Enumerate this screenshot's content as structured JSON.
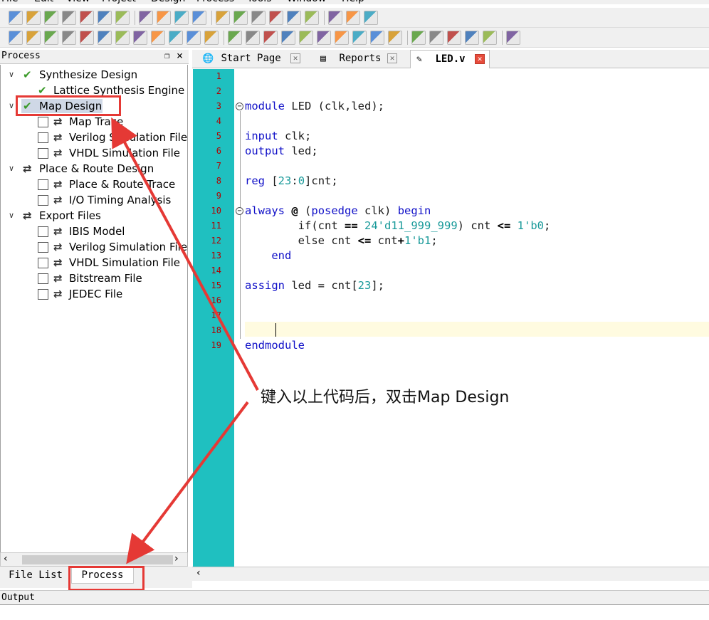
{
  "menu": [
    "File",
    "Edit",
    "View",
    "Project",
    "Design",
    "Process",
    "Tools",
    "Window",
    "Help"
  ],
  "process_panel": {
    "title": "Process",
    "pin_icon": "pin-icon",
    "close_icon": "close-icon",
    "tree": [
      {
        "label": "Synthesize Design",
        "icon": "check-icon",
        "level": 0,
        "expanded": true
      },
      {
        "label": "Lattice Synthesis Engine",
        "icon": "check-icon",
        "level": 1
      },
      {
        "label": "Map Design",
        "icon": "check-icon",
        "level": 0,
        "expanded": true,
        "selected": true
      },
      {
        "label": "Map Trace",
        "icon": "sync-icon",
        "level": 1,
        "checkbox": true
      },
      {
        "label": "Verilog Simulation File",
        "icon": "sync-icon",
        "level": 1,
        "checkbox": true
      },
      {
        "label": "VHDL Simulation File",
        "icon": "sync-icon",
        "level": 1,
        "checkbox": true
      },
      {
        "label": "Place & Route Design",
        "icon": "sync-icon",
        "level": 0,
        "expanded": true
      },
      {
        "label": "Place & Route Trace",
        "icon": "sync-icon",
        "level": 1,
        "checkbox": true
      },
      {
        "label": "I/O Timing Analysis",
        "icon": "sync-icon",
        "level": 1,
        "checkbox": true
      },
      {
        "label": "Export Files",
        "icon": "sync-icon",
        "level": 0,
        "expanded": true
      },
      {
        "label": "IBIS Model",
        "icon": "sync-icon",
        "level": 1,
        "checkbox": true
      },
      {
        "label": "Verilog Simulation File",
        "icon": "sync-icon",
        "level": 1,
        "checkbox": true
      },
      {
        "label": "VHDL Simulation File",
        "icon": "sync-icon",
        "level": 1,
        "checkbox": true
      },
      {
        "label": "Bitstream File",
        "icon": "sync-icon",
        "level": 1,
        "checkbox": true
      },
      {
        "label": "JEDEC File",
        "icon": "sync-icon",
        "level": 1,
        "checkbox": true
      }
    ]
  },
  "bottom_tabs": [
    {
      "label": "File List",
      "active": false
    },
    {
      "label": "Process",
      "active": true
    }
  ],
  "editor_tabs": [
    {
      "label": "Start Page",
      "icon": "globe-page-icon",
      "active": false
    },
    {
      "label": "Reports",
      "icon": "report-icon",
      "active": false
    },
    {
      "label": "LED.v",
      "icon": "edit-file-icon",
      "active": true
    }
  ],
  "editor": {
    "line_numbers": [
      "1",
      "2",
      "3",
      "4",
      "5",
      "6",
      "7",
      "8",
      "9",
      "10",
      "11",
      "12",
      "13",
      "14",
      "15",
      "16",
      "17",
      "18",
      "19"
    ],
    "lines": [
      "",
      "",
      "module LED (clk,led);",
      "",
      "input clk;",
      "output led;",
      "",
      "reg [23:0]cnt;",
      "",
      "always @ (posedge clk) begin",
      "        if(cnt == 24'd11_999_999) cnt <= 1'b0;",
      "        else cnt <= cnt+1'b1;",
      "    end",
      "",
      "assign led = cnt[23];",
      "",
      "",
      "",
      "endmodule"
    ],
    "current_line": 18
  },
  "output_panel": {
    "title": "Output"
  },
  "annotation": {
    "text": "键入以上代码后，双击Map Design"
  },
  "colors": {
    "gutter": "#1fc0c0",
    "highlight_box": "#e53935",
    "keyword": "#1010c8",
    "number": "#1a9a9a",
    "line_number": "#b00000",
    "current_line": "#fffbe0"
  }
}
